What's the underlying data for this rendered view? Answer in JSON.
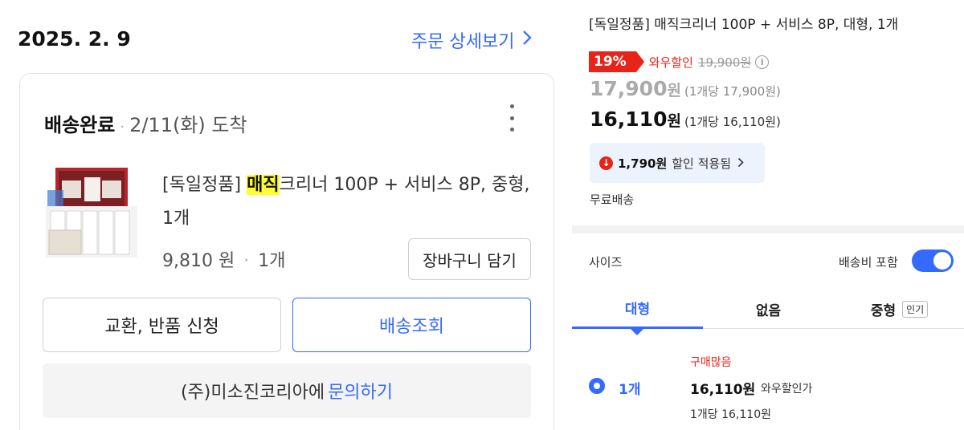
{
  "order": {
    "date": "2025. 2. 9",
    "detail_link": "주문 상세보기",
    "status": "배송완료",
    "arrival": "2/11(화) 도착",
    "product": {
      "name_prefix": "[독일정품] ",
      "name_highlight": "매직",
      "name_suffix": "크리너 100P + 서비스 8P, 중형, 1개",
      "price": "9,810 원",
      "qty": "1개"
    },
    "add_to_cart": "장바구니 담기",
    "return_button": "교환, 반품 신청",
    "track_button": "배송조회",
    "inquiry_seller": "(주)미소진코리아에",
    "inquiry_link": "문의하기"
  },
  "product_panel": {
    "title": "[독일정품] 매직크리너 100P + 서비스 8P, 대형, 1개",
    "discount_rate": "19%",
    "wow_label": "와우할인",
    "original_price": "19,900원",
    "price_regular": "17,900",
    "price_regular_won": "원",
    "price_regular_unit": "(1개당 17,900원)",
    "price_wow": "16,110",
    "price_wow_won": "원",
    "price_wow_unit": "(1개당 16,110원)",
    "coupon_amount": "1,790원",
    "coupon_label": "할인 적용됨",
    "free_shipping": "무료배송",
    "size_label": "사이즈",
    "shipping_included": "배송비 포함",
    "shipping_included_on": true,
    "tabs": [
      "대형",
      "없음",
      "중형"
    ],
    "popular_badge": "인기",
    "option": {
      "hot_label": "구매많음",
      "qty": "1개",
      "price": "16,110원",
      "wow": "와우할인가",
      "unit": "1개당 16,110원"
    }
  },
  "colors": {
    "accent": "#346aff",
    "discount_red": "#e7241a",
    "highlight": "#ffff2e"
  }
}
